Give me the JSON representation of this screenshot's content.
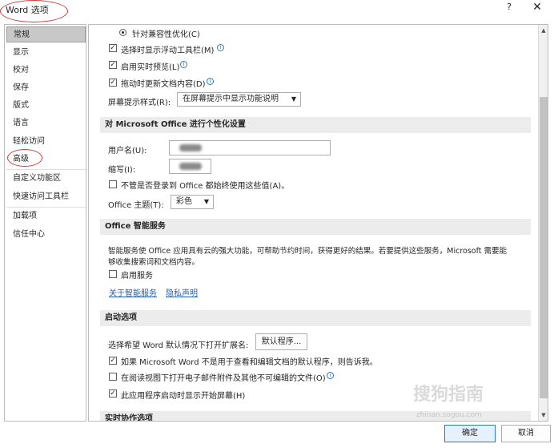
{
  "window": {
    "title": "Word 选项",
    "help_label": "?",
    "close_label": "✕"
  },
  "nav": {
    "items": [
      {
        "label": "常规",
        "selected": true
      },
      {
        "label": "显示"
      },
      {
        "label": "校对"
      },
      {
        "label": "保存"
      },
      {
        "label": "版式"
      },
      {
        "label": "语言"
      },
      {
        "label": "轻松访问"
      },
      {
        "label": "高级"
      },
      {
        "label": "自定义功能区"
      },
      {
        "label": "快速访问工具栏"
      },
      {
        "label": "加载项"
      },
      {
        "label": "信任中心"
      }
    ]
  },
  "ui_options": {
    "compat_radio_label": "针对兼容性优化(C)",
    "mini_toolbar_label": "选择时显示浮动工具栏(M)",
    "live_preview_label": "启用实时预览(L)",
    "update_drag_label": "拖动时更新文档内容(D)",
    "screentip_label": "屏幕提示样式(R):",
    "screentip_value": "在屏幕提示中显示功能说明"
  },
  "personalize": {
    "header": "对 Microsoft Office 进行个性化设置",
    "username_label": "用户名(U):",
    "initials_label": "缩写(I):",
    "always_use_label": "不管是否登录到 Office 都始终使用这些值(A)。",
    "theme_label": "Office 主题(T):",
    "theme_value": "彩色"
  },
  "intelligent": {
    "header": "Office 智能服务",
    "description_line1": "智能服务使 Office 应用具有云的强大功能，可帮助节约时间，获得更好的结果。若要提供这些服务，Microsoft 需要能",
    "description_line2": "够收集搜索词和文档内容。",
    "enable_label": "启用服务",
    "about_link": "关于智能服务",
    "privacy_link": "隐私声明"
  },
  "startup": {
    "header": "启动选项",
    "ext_label": "选择希望 Word 默认情况下打开扩展名:",
    "default_programs_button": "默认程序...",
    "tell_me_label": "如果 Microsoft Word 不是用于查看和编辑文档的默认程序，则告诉我。",
    "reading_view_label": "在阅读视图下打开电子邮件附件及其他不可编辑的文件(O)",
    "start_screen_label": "此应用程序启动时显示开始屏幕(H)"
  },
  "collab": {
    "header": "实时协作选项"
  },
  "footer": {
    "ok_label": "确定",
    "cancel_label": "取消"
  },
  "checks": {
    "mark": "✓",
    "info": "i"
  },
  "scroll": {
    "up": "▲",
    "down": "▼"
  },
  "dropdown_arrow": "▼",
  "watermark": {
    "text": "搜狗指南",
    "url": "zhinan.sogou.com"
  },
  "colors": {
    "accent": "#2b79c2",
    "annotation": "#d03a3a",
    "section_bg": "#ececec"
  }
}
